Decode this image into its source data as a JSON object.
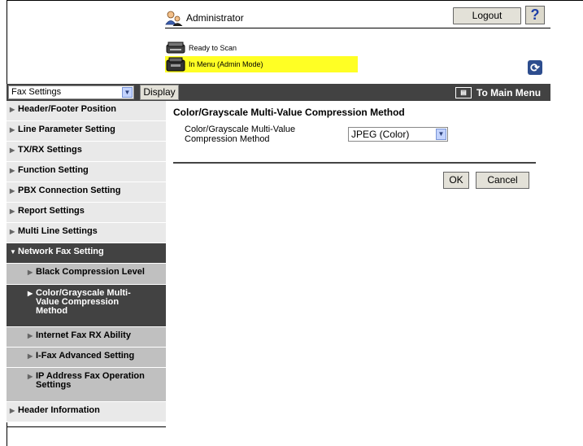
{
  "header": {
    "user_label": "Administrator",
    "logout_label": "Logout",
    "help_label": "?",
    "status_ready": "Ready to Scan",
    "status_menu": "In Menu (Admin Mode)",
    "highlight_color": "#ffff24"
  },
  "toolbar": {
    "category_selected": "Fax Settings",
    "display_label": "Display",
    "to_main_label": "To Main Menu",
    "bg_color": "#424242"
  },
  "sidebar": {
    "items": [
      {
        "label": "Header/Footer Position"
      },
      {
        "label": "Line Parameter Setting"
      },
      {
        "label": "TX/RX Settings"
      },
      {
        "label": "Function Setting"
      },
      {
        "label": "PBX Connection Setting"
      },
      {
        "label": "Report Settings"
      },
      {
        "label": "Multi Line Settings"
      },
      {
        "label": "Network Fax Setting"
      },
      {
        "label": "Black Compression Level"
      },
      {
        "label": "Color/Grayscale Multi-Value Compression Method"
      },
      {
        "label": "Internet Fax RX Ability"
      },
      {
        "label": "I-Fax Advanced Setting"
      },
      {
        "label": "IP Address Fax Operation Settings"
      },
      {
        "label": "Header Information"
      }
    ]
  },
  "main": {
    "title": "Color/Grayscale Multi-Value Compression Method",
    "field_label": "Color/Grayscale Multi-Value Compression Method",
    "field_value": "JPEG (Color)",
    "ok_label": "OK",
    "cancel_label": "Cancel"
  }
}
